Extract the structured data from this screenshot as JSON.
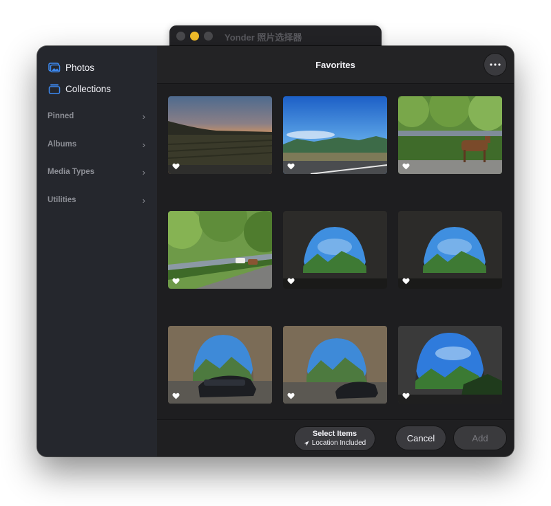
{
  "app": {
    "title": "Yonder 照片选择器"
  },
  "sidebar": {
    "items": [
      {
        "label": "Photos",
        "icon": "photos-icon"
      },
      {
        "label": "Collections",
        "icon": "collections-icon"
      }
    ],
    "sections": [
      {
        "label": "Pinned"
      },
      {
        "label": "Albums"
      },
      {
        "label": "Media Types"
      },
      {
        "label": "Utilities"
      }
    ]
  },
  "header": {
    "title": "Favorites",
    "more_icon": "ellipsis-icon"
  },
  "photos": [
    {
      "scene": "sunset-field",
      "favorite": true
    },
    {
      "scene": "blue-sky-road",
      "favorite": true
    },
    {
      "scene": "roadside-goat",
      "favorite": true
    },
    {
      "scene": "mountain-road-goats",
      "favorite": true
    },
    {
      "scene": "cave-arch",
      "favorite": true
    },
    {
      "scene": "cave-arch",
      "favorite": true
    },
    {
      "scene": "cave-car",
      "favorite": true
    },
    {
      "scene": "cave-car",
      "favorite": true
    },
    {
      "scene": "cave-arch-wide",
      "favorite": true
    }
  ],
  "footer": {
    "select_title": "Select Items",
    "location_label": "Location Included",
    "cancel_label": "Cancel",
    "add_label": "Add"
  },
  "colors": {
    "accent": "#3d8bf5",
    "traffic_yellow": "#f5bf2a"
  }
}
